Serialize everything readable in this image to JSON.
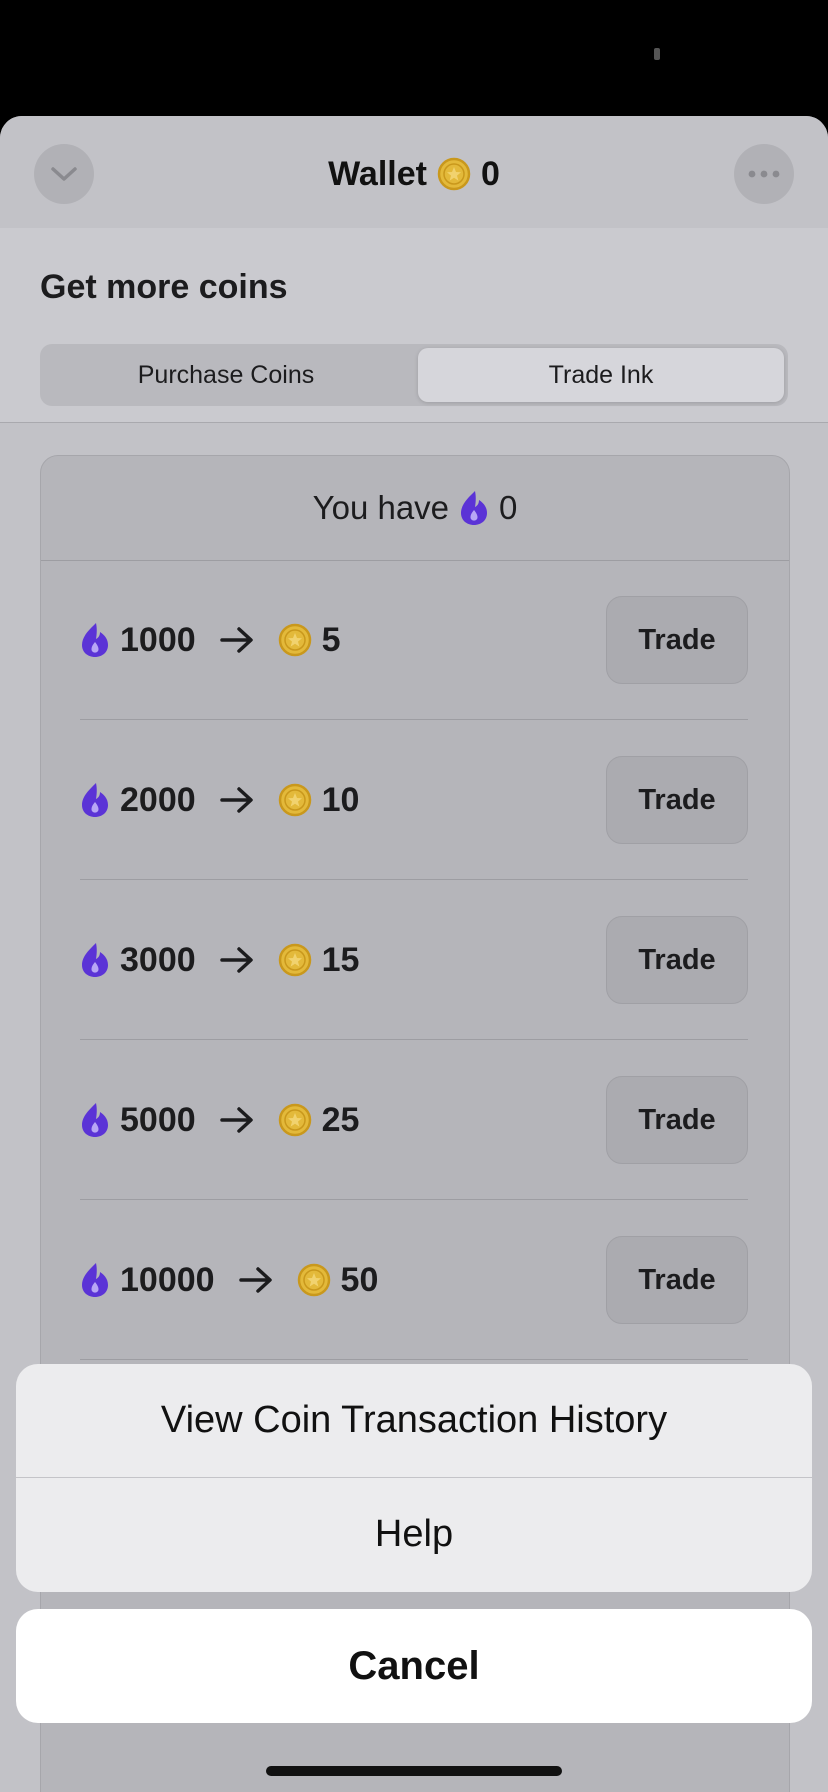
{
  "header": {
    "title": "Wallet",
    "coin_balance": "0",
    "back_icon": "chevron-down-icon",
    "more_icon": "ellipsis-icon"
  },
  "section": {
    "title": "Get more coins"
  },
  "tabs": [
    {
      "label": "Purchase Coins",
      "selected": false
    },
    {
      "label": "Trade Ink",
      "selected": true
    }
  ],
  "ink_balance": {
    "prefix": "You have",
    "value": "0"
  },
  "trades": [
    {
      "ink": "1000",
      "coins": "5",
      "button": "Trade"
    },
    {
      "ink": "2000",
      "coins": "10",
      "button": "Trade"
    },
    {
      "ink": "3000",
      "coins": "15",
      "button": "Trade"
    },
    {
      "ink": "5000",
      "coins": "25",
      "button": "Trade"
    },
    {
      "ink": "10000",
      "coins": "50",
      "button": "Trade"
    }
  ],
  "action_sheet": {
    "items": [
      {
        "label": "View Coin Transaction History"
      },
      {
        "label": "Help"
      }
    ],
    "cancel": "Cancel"
  },
  "colors": {
    "ink": "#5b33d6",
    "coin": "#e3b93a",
    "coin_border": "#c9981c"
  }
}
